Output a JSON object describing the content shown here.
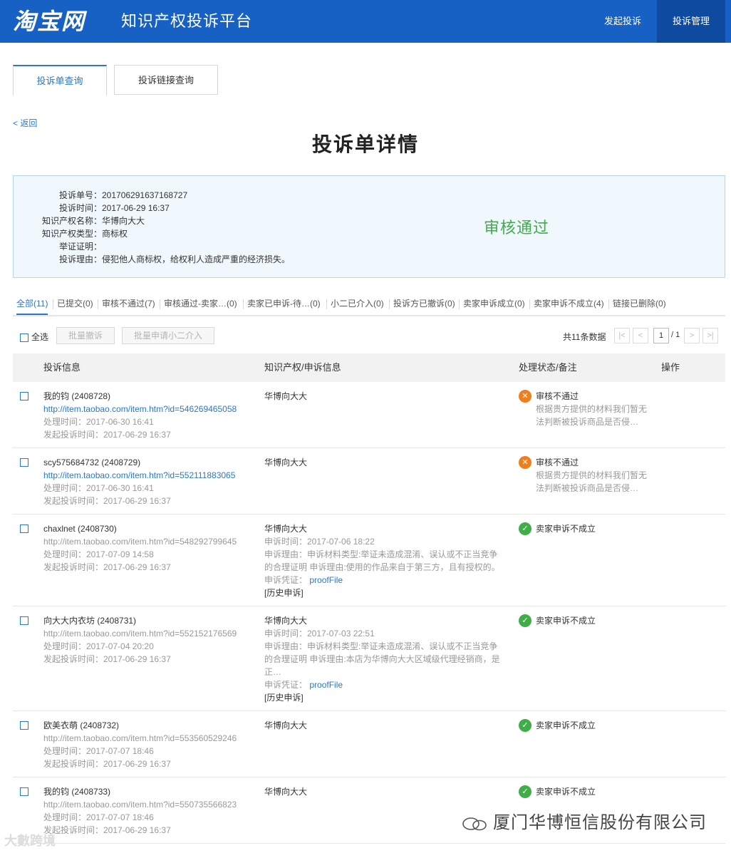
{
  "header": {
    "logo": "淘宝网",
    "title": "知识产权投诉平台",
    "nav": {
      "launch": "发起投诉",
      "manage": "投诉管理"
    }
  },
  "tabs": [
    {
      "label": "投诉单查询"
    },
    {
      "label": "投诉链接查询"
    }
  ],
  "back": "< 返回",
  "page_title": "投诉单详情",
  "info": {
    "rows": [
      {
        "label": "投诉单号：",
        "value": "201706291637168727"
      },
      {
        "label": "投诉时间：",
        "value": "2017-06-29 16:37"
      },
      {
        "label": "知识产权名称：",
        "value": "华博向大大"
      },
      {
        "label": "知识产权类型：",
        "value": "商标权"
      },
      {
        "label": "举证证明：",
        "value": ""
      },
      {
        "label": "投诉理由：",
        "value": "侵犯他人商标权，给权利人造成严重的经济损失。"
      }
    ],
    "status": "审核通过",
    "status_color": "#3fae49"
  },
  "filters": [
    "全部(11)",
    "已提交(0)",
    "审核不通过(7)",
    "审核通过-卖家…(0)",
    "卖家已申诉-待…(0)",
    "小二已介入(0)",
    "投诉方已撤诉(0)",
    "卖家申诉成立(0)",
    "卖家申诉不成立(4)",
    "链接已删除(0)"
  ],
  "toolbar": {
    "select_all": "全选",
    "batch_cancel": "批量撤诉",
    "batch_apply": "批量申请小二介入",
    "total": "共11条数据",
    "page_current": "1",
    "page_total": "/ 1"
  },
  "table": {
    "headers": [
      "投诉信息",
      "知识产权/申诉信息",
      "处理状态/备注",
      "操作"
    ],
    "rows": [
      {
        "seller": "我的钧 (2408728)",
        "url": "http://item.taobao.com/item.htm?id=546269465058",
        "url_is_link": true,
        "handle_time": "处理时间：2017-06-30 16:41",
        "launch_time": "发起投诉时间：2017-06-29 16:37",
        "ip_name": "华博向大大",
        "appeal": null,
        "status": "审核不通过",
        "status_type": "fail",
        "note": [
          "根据贵方提供的材料我们暂无",
          "法判断被投诉商品是否侵…"
        ]
      },
      {
        "seller": "scy575684732 (2408729)",
        "url": "http://item.taobao.com/item.htm?id=552111883065",
        "url_is_link": true,
        "handle_time": "处理时间：2017-06-30 16:41",
        "launch_time": "发起投诉时间：2017-06-29 16:37",
        "ip_name": "华博向大大",
        "appeal": null,
        "status": "审核不通过",
        "status_type": "fail",
        "note": [
          "根据贵方提供的材料我们暂无",
          "法判断被投诉商品是否侵…"
        ]
      },
      {
        "seller": "chaxlnet (2408730)",
        "url": "http://item.taobao.com/item.htm?id=548292799645",
        "url_is_link": false,
        "handle_time": "处理时间：2017-07-09 14:58",
        "launch_time": "发起投诉时间：2017-06-29 16:37",
        "ip_name": "华博向大大",
        "appeal": {
          "time": "申诉时间：2017-07-06 18:22",
          "reason": "申诉理由：申诉材料类型:举证未造成混淆、误认或不正当竞争的合理证明 申诉理由:使用的作品来自于第三方，且有授权的。",
          "proof_label": "申诉凭证：",
          "proof_link": "proofFile",
          "history": "[历史申诉]"
        },
        "status": "卖家申诉不成立",
        "status_type": "ok",
        "note": []
      },
      {
        "seller": "向大大内衣坊 (2408731)",
        "url": "http://item.taobao.com/item.htm?id=552152176569",
        "url_is_link": false,
        "handle_time": "处理时间：2017-07-04 20:20",
        "launch_time": "发起投诉时间：2017-06-29 16:37",
        "ip_name": "华博向大大",
        "appeal": {
          "time": "申诉时间：2017-07-03 22:51",
          "reason": "申诉理由：申诉材料类型:举证未造成混淆、误认或不正当竞争的合理证明 申诉理由:本店为华博向大大区域级代理经销商，是正…",
          "proof_label": "申诉凭证：",
          "proof_link": "proofFile",
          "history": "[历史申诉]"
        },
        "status": "卖家申诉不成立",
        "status_type": "ok",
        "note": []
      },
      {
        "seller": "欧美衣萌 (2408732)",
        "url": "http://item.taobao.com/item.htm?id=553560529246",
        "url_is_link": false,
        "handle_time": "处理时间：2017-07-07 18:46",
        "launch_time": "发起投诉时间：2017-06-29 16:37",
        "ip_name": "华博向大大",
        "appeal": null,
        "status": "卖家申诉不成立",
        "status_type": "ok",
        "note": []
      },
      {
        "seller": "我的钧 (2408733)",
        "url": "http://item.taobao.com/item.htm?id=550735566823",
        "url_is_link": false,
        "handle_time": "处理时间：2017-07-07 18:46",
        "launch_time": "发起投诉时间：2017-06-29 16:37",
        "ip_name": "华博向大大",
        "appeal": null,
        "status": "卖家申诉不成立",
        "status_type": "ok",
        "note": []
      }
    ]
  },
  "watermark": {
    "company": "厦门华博恒信股份有限公司",
    "corner": "大數跨境"
  },
  "colors": {
    "brand": "#1760c4",
    "link": "#2d77c8",
    "fail": "#ef7f1a",
    "ok": "#3fae49"
  },
  "icons": {
    "fail": "x-circle-icon",
    "ok": "check-circle-icon",
    "wechat": "wechat-icon"
  }
}
